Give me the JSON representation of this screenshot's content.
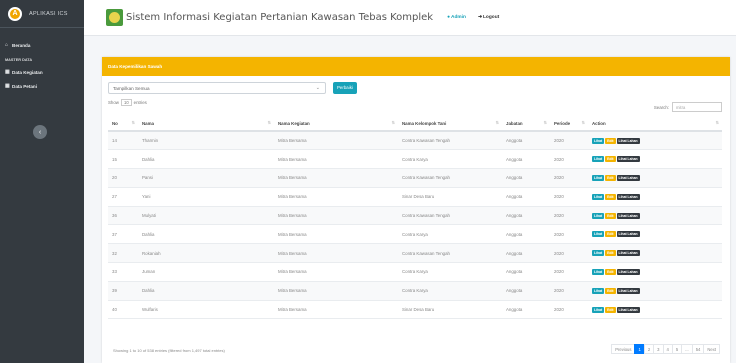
{
  "brand": {
    "name": "APLIKASI ICS",
    "logo_letter": "A"
  },
  "sidebar": {
    "items": [
      {
        "label": "Beranda",
        "icon": "home-icon",
        "glyph": "⌂"
      }
    ],
    "header": "MASTER DATA",
    "master_items": [
      {
        "label": "Data Kegiatan",
        "icon": "table-icon",
        "glyph": "▦"
      },
      {
        "label": "Data Petani",
        "icon": "table-icon",
        "glyph": "▦"
      }
    ],
    "collapse_glyph": "‹"
  },
  "topbar": {
    "title": "Sistem Informasi Kegiatan Pertanian Kawasan Tebas Komplek",
    "admin_label": "Admin",
    "logout_label": "Logout"
  },
  "card": {
    "header": "Data Kepemilikan Sawah",
    "select_value": "Tampilkan Semua",
    "filter_button": "Perbaiki",
    "show_prefix": "Show",
    "show_value": "10",
    "show_suffix": "entries",
    "search_label": "Search:",
    "search_value": "mitra"
  },
  "table": {
    "columns": [
      "No",
      "Nama",
      "Nama Kegiatan",
      "Nama Kelompok Tani",
      "Jabatan",
      "Periode",
      "Action"
    ],
    "rows": [
      {
        "no": "14",
        "nama": "Tharmin",
        "kegiatan": "Mitra Bersama",
        "kelompok": "Contra Kawasan Tengah",
        "jabatan": "Anggota",
        "periode": "2020"
      },
      {
        "no": "15",
        "nama": "Dahlia",
        "kegiatan": "Mitra Bersama",
        "kelompok": "Contra Karya",
        "jabatan": "Anggota",
        "periode": "2020"
      },
      {
        "no": "20",
        "nama": "Pansi",
        "kegiatan": "Mitra Bersama",
        "kelompok": "Contra Kawasan Tengah",
        "jabatan": "Anggota",
        "periode": "2020"
      },
      {
        "no": "27",
        "nama": "Yani",
        "kegiatan": "Mitra Bersama",
        "kelompok": "Sinar Desa Baru",
        "jabatan": "Anggota",
        "periode": "2020"
      },
      {
        "no": "36",
        "nama": "Mulyati",
        "kegiatan": "Mitra Bersama",
        "kelompok": "Contra Kawasan Tengah",
        "jabatan": "Anggota",
        "periode": "2020"
      },
      {
        "no": "37",
        "nama": "Dahlia",
        "kegiatan": "Mitra Bersama",
        "kelompok": "Contra Karya",
        "jabatan": "Anggota",
        "periode": "2020"
      },
      {
        "no": "32",
        "nama": "Rokaniah",
        "kegiatan": "Mitra Bersama",
        "kelompok": "Contra Kawasan Tengah",
        "jabatan": "Anggota",
        "periode": "2020"
      },
      {
        "no": "33",
        "nama": "Juman",
        "kegiatan": "Mitra Bersama",
        "kelompok": "Contra Karya",
        "jabatan": "Anggota",
        "periode": "2020"
      },
      {
        "no": "39",
        "nama": "Dahlia",
        "kegiatan": "Mitra Bersama",
        "kelompok": "Contra Karya",
        "jabatan": "Anggota",
        "periode": "2020"
      },
      {
        "no": "40",
        "nama": "Wulfaris",
        "kegiatan": "Mitra Bersama",
        "kelompok": "Sinar Desa Baru",
        "jabatan": "Anggota",
        "periode": "2020"
      }
    ],
    "actions": {
      "lihat": "Lihat",
      "edit": "Edit",
      "lahan": "Lihat Lahan"
    }
  },
  "footer": {
    "info": "Showing 1 to 10 of 538 entries (filtered from 1,497 total entries)",
    "pages": [
      "Previous",
      "1",
      "2",
      "3",
      "4",
      "5",
      "...",
      "54",
      "Next"
    ],
    "active_page": "1"
  },
  "colors": {
    "accent": "#f4b400",
    "sidebar": "#343a40",
    "info": "#17a2b8",
    "primary": "#007bff"
  }
}
